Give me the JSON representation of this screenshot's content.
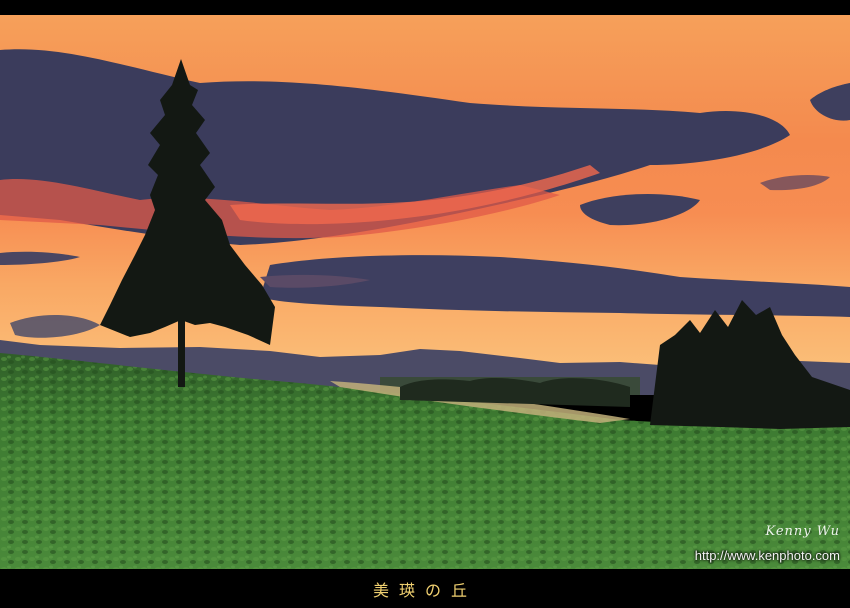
{
  "photo": {
    "description_icon": "landscape-photo",
    "colors": {
      "sky_top": "#f7a458",
      "sky_mid": "#f5884a",
      "sky_horizon": "#f8b86a",
      "cloud_dark": "#3c3e5e",
      "cloud_glow": "#e8584a",
      "hills": "#4a4a62",
      "field": "#3f7a32",
      "field_dark": "#2c5a24",
      "tree": "#141a14"
    }
  },
  "watermark": {
    "signature": "Kenny Wu",
    "url": "http://www.kenphoto.com"
  },
  "caption": {
    "title": "美瑛の丘"
  }
}
